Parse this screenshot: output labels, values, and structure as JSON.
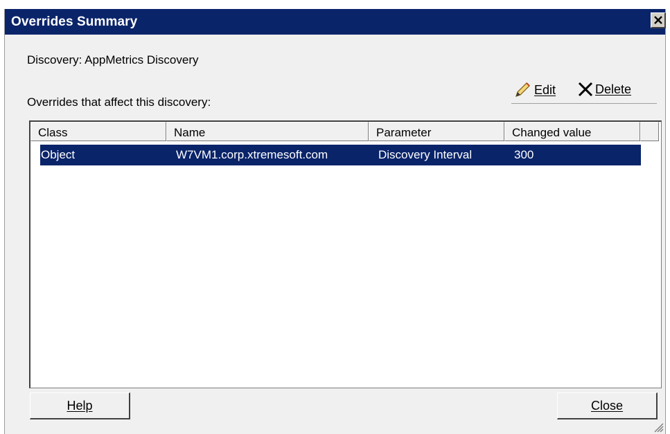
{
  "window": {
    "title": "Overrides Summary"
  },
  "discovery_label": "Discovery: AppMetrics Discovery",
  "overrides_label": "Overrides that affect this discovery:",
  "toolbar": {
    "edit_label": "Edit",
    "delete_label": "Delete"
  },
  "table": {
    "columns": [
      "Class",
      "Name",
      "Parameter",
      "Changed value"
    ],
    "rows": [
      [
        "Object",
        "W7VM1.corp.xtremesoft.com",
        "Discovery Interval",
        "300"
      ]
    ]
  },
  "buttons": {
    "help_label": "Help",
    "close_label": "Close"
  },
  "colors": {
    "titlebar": "#0a246a",
    "selection": "#0a246a",
    "dialog_bg": "#f0f0f0"
  }
}
